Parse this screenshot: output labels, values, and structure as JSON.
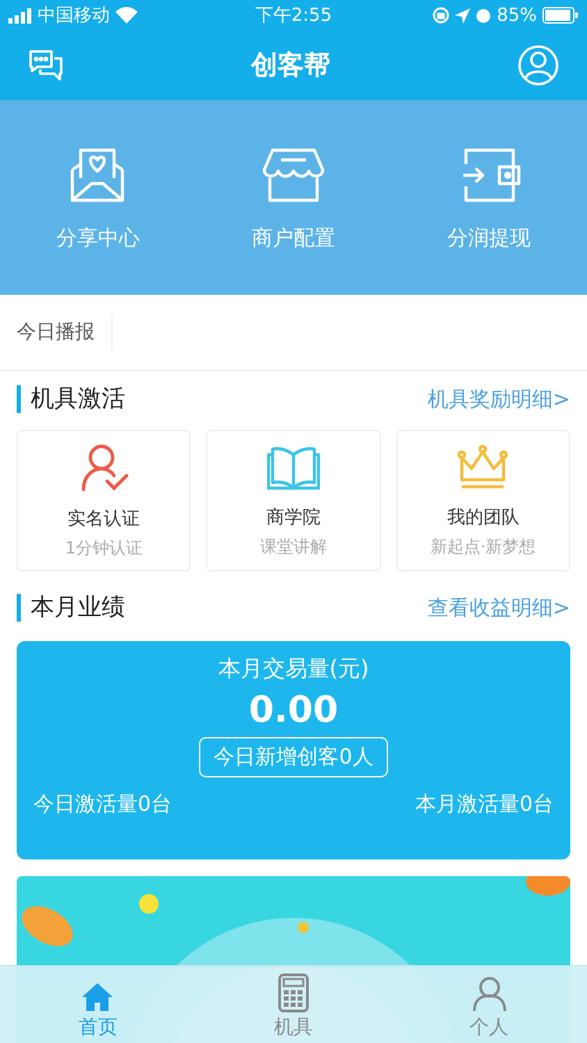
{
  "status_bar": {
    "carrier": "中国移动",
    "time": "下午2:55",
    "battery": "85%"
  },
  "nav": {
    "title": "创客帮"
  },
  "quick_menu": [
    {
      "label": "分享中心",
      "kind": "envelope"
    },
    {
      "label": "商户配置",
      "kind": "store"
    },
    {
      "label": "分润提现",
      "kind": "wallet"
    }
  ],
  "ticker": {
    "label": "今日播报"
  },
  "activation": {
    "title": "机具激活",
    "link": "机具奖励明细>",
    "cards": [
      {
        "title": "实名认证",
        "subtitle": "1分钟认证",
        "kind": "person"
      },
      {
        "title": "商学院",
        "subtitle": "课堂讲解",
        "kind": "book"
      },
      {
        "title": "我的团队",
        "subtitle": "新起点·新梦想",
        "kind": "crown"
      }
    ]
  },
  "performance": {
    "title": "本月业绩",
    "link": "查看收益明细>",
    "volume_label": "本月交易量(元)",
    "volume": "0.00",
    "new_makers": "今日新增创客0人",
    "today_activations": "今日激活量0台",
    "month_activations": "本月激活量0台"
  },
  "tab_bar": [
    {
      "label": "首页",
      "kind": "home",
      "selected": true
    },
    {
      "label": "机具",
      "kind": "calculator",
      "selected": false
    },
    {
      "label": "个人",
      "kind": "person",
      "selected": false
    }
  ]
}
